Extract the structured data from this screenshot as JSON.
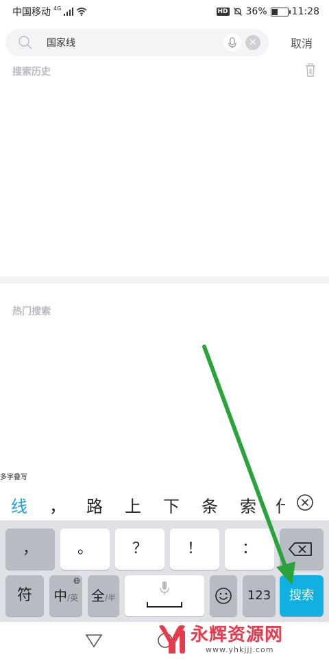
{
  "status_bar": {
    "carrier": "中国移动",
    "network": "4G",
    "hd": "HD",
    "battery": "36%",
    "battery_level": 0.36,
    "time": "11:28"
  },
  "search": {
    "query": "国家线",
    "cancel_label": "取消"
  },
  "history": {
    "title": "搜索历史"
  },
  "hot": {
    "title": "热门搜索"
  },
  "ime": {
    "hint": "多字叠写",
    "candidates": [
      "线",
      "，",
      "路",
      "上",
      "下",
      "条",
      "索",
      "什"
    ]
  },
  "keyboard": {
    "row1": [
      "，",
      "。",
      "？",
      "！",
      "："
    ],
    "sym_label": "符",
    "lang_main": "中",
    "lang_sub": "/英",
    "width_main": "全",
    "width_sub": "/半",
    "num_label": "123",
    "search_label": "搜索"
  },
  "watermark": {
    "text": "永辉资源网",
    "url": "www.yhkjjj.com"
  },
  "colors": {
    "accent": "#12b0e0",
    "candidate_highlight": "#1ea3d6",
    "arrow": "#2aa43a",
    "watermark": "#e73a4c"
  }
}
